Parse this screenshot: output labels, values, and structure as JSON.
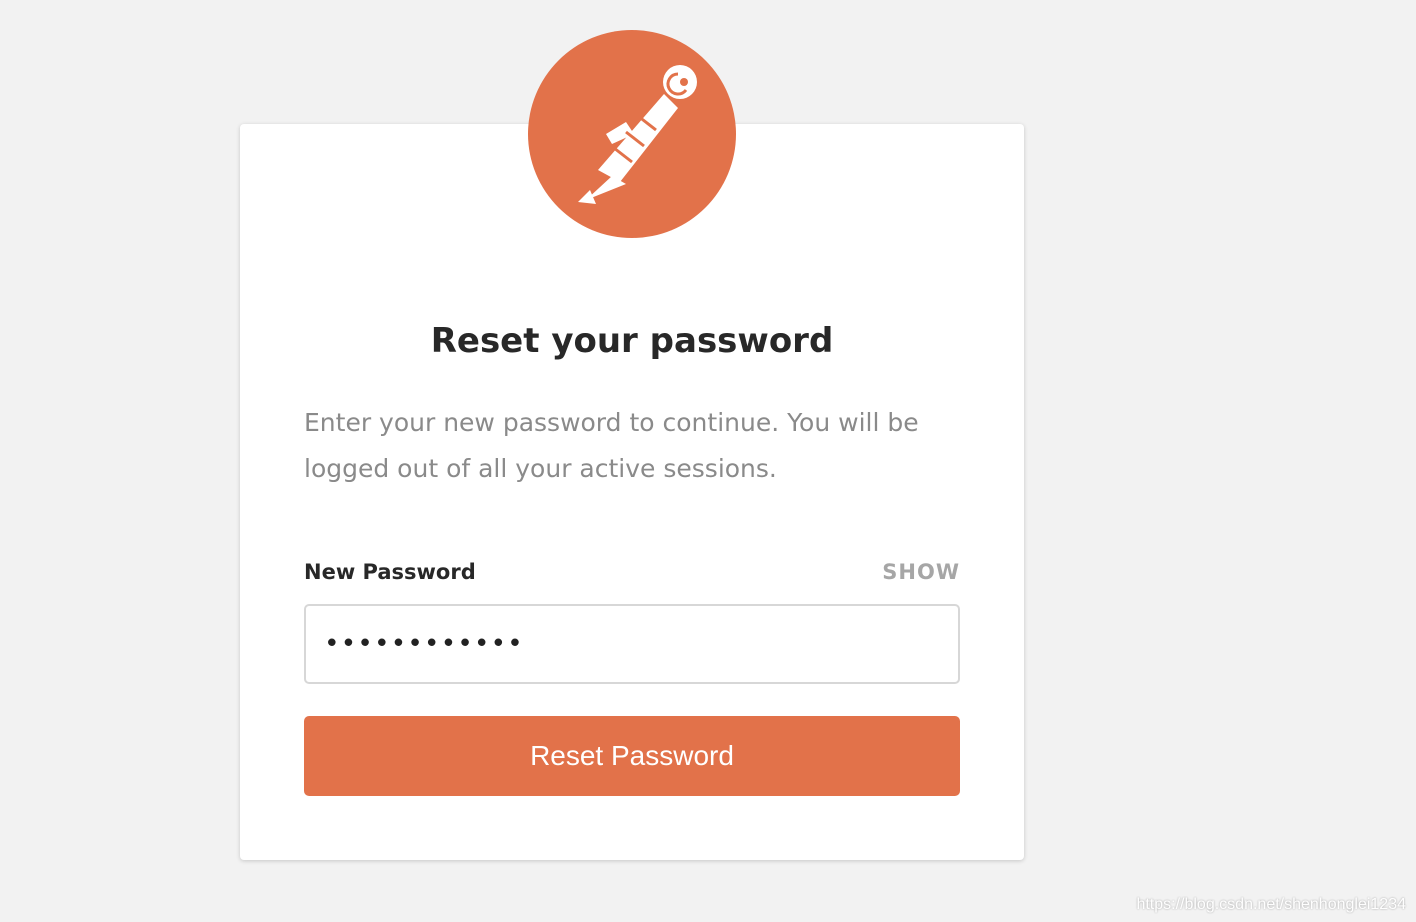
{
  "brand": {
    "logo_icon": "postman-astronaut-logo-icon",
    "accent_color": "#e2724a"
  },
  "reset_form": {
    "title": "Reset your password",
    "subtitle": "Enter your new password to continue. You will be logged out of all your active sessions.",
    "password_label": "New Password",
    "show_toggle_label": "SHOW",
    "password_value": "••••••••••••",
    "submit_label": "Reset Password"
  },
  "watermark": {
    "text": "https://blog.csdn.net/shenhonglei1234"
  }
}
